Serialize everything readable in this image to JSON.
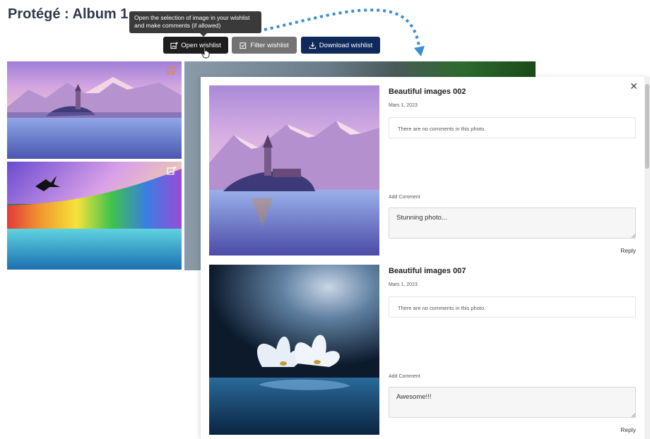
{
  "page": {
    "title": "Protégé : Album 1"
  },
  "tooltip": {
    "text": "Open the selection of image in your wishlist and make comments (if allowed)"
  },
  "toolbar": {
    "open_label": "Open wishlist",
    "filter_label": "Filter wishlist",
    "download_label": "Download wishlist"
  },
  "gallery": {
    "thumbnails": [
      {
        "icon": "add-to-wishlist-icon",
        "icon_color": "#e8873a"
      },
      {
        "icon": "add-to-wishlist-icon",
        "icon_color": "#ffffff"
      }
    ]
  },
  "wishlist_panel": {
    "close_symbol": "✕",
    "items": [
      {
        "title": "Beautiful images 002",
        "date": "Mars 1, 2023",
        "comments_text": "There are no comments in this photo.",
        "add_comment_label": "Add Comment",
        "comment_value": "Stunning photo...",
        "reply_label": "Reply"
      },
      {
        "title": "Beautiful images 007",
        "date": "Mars 1, 2023",
        "comments_text": "There are no comments in this photo.",
        "add_comment_label": "Add Comment",
        "comment_value": "Awesome!!!",
        "reply_label": "Reply"
      }
    ]
  },
  "colors": {
    "arrow": "#3b8fd0",
    "open_button": "#1e1e1e",
    "filter_button": "#737373",
    "download_button": "#0f2a5a",
    "title": "#2f3a4a"
  }
}
